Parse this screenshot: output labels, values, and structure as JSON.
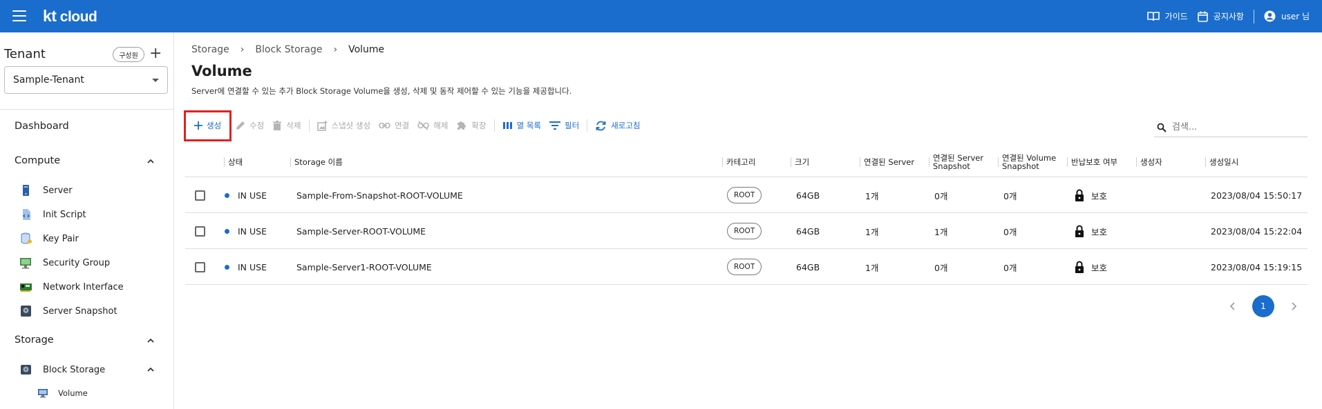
{
  "header": {
    "logo_kt": "kt",
    "logo_cloud": "cloud",
    "guide": "가이드",
    "notice": "공지사항",
    "user": "user 님",
    "brand_color": "#1a6dcc"
  },
  "sidebar": {
    "tenant_title": "Tenant",
    "member_chip": "구성원",
    "tenant_selected": "Sample-Tenant",
    "dashboard": "Dashboard",
    "compute_head": "Compute",
    "compute_items": [
      "Server",
      "Init Script",
      "Key Pair",
      "Security Group",
      "Network Interface",
      "Server Snapshot"
    ],
    "storage_head": "Storage",
    "block_storage": "Block Storage",
    "volume": "Volume"
  },
  "breadcrumb": [
    "Storage",
    "Block Storage",
    "Volume"
  ],
  "page": {
    "title": "Volume",
    "description": "Server에 연결할 수 있는 추가 Block Storage Volume을 생성, 삭제 및 동작 제어할 수 있는 기능을 제공합니다."
  },
  "toolbar": {
    "create": "생성",
    "edit": "수정",
    "delete": "삭제",
    "snapshot": "스냅샷 생성",
    "attach": "연결",
    "detach": "해제",
    "extend": "확장",
    "columns": "열 목록",
    "filter": "필터",
    "refresh": "새로고침"
  },
  "search": {
    "placeholder": "검색..."
  },
  "table": {
    "headers": {
      "status": "상태",
      "name": "Storage 이름",
      "category": "카테고리",
      "size": "크기",
      "server": "연결된 Server",
      "server_snapshot_1": "연결된 Server",
      "server_snapshot_2": "Snapshot",
      "volume_snapshot_1": "연결된 Volume",
      "volume_snapshot_2": "Snapshot",
      "protect": "반납보호 여부",
      "creator": "생성자",
      "created": "생성일시"
    },
    "rows": [
      {
        "status": "IN USE",
        "name": "Sample-From-Snapshot-ROOT-VOLUME",
        "category": "ROOT",
        "size": "64GB",
        "server": "1개",
        "server_snap": "0개",
        "volume_snap": "0개",
        "protect": "보호",
        "creator": "",
        "created": "2023/08/04 15:50:17"
      },
      {
        "status": "IN USE",
        "name": "Sample-Server-ROOT-VOLUME",
        "category": "ROOT",
        "size": "64GB",
        "server": "1개",
        "server_snap": "1개",
        "volume_snap": "0개",
        "protect": "보호",
        "creator": "",
        "created": "2023/08/04 15:22:04"
      },
      {
        "status": "IN USE",
        "name": "Sample-Server1-ROOT-VOLUME",
        "category": "ROOT",
        "size": "64GB",
        "server": "1개",
        "server_snap": "0개",
        "volume_snap": "0개",
        "protect": "보호",
        "creator": "",
        "created": "2023/08/04 15:19:15"
      }
    ]
  },
  "pagination": {
    "current_page": "1"
  }
}
